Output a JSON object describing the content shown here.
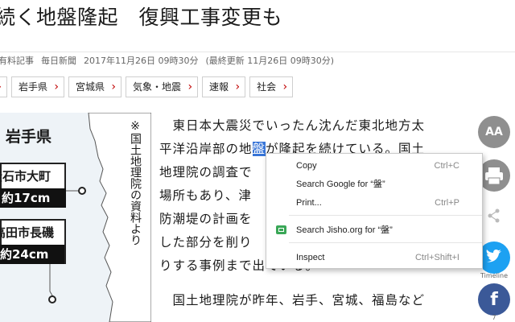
{
  "article": {
    "headline": "続く地盤隆起　復興工事変更も",
    "meta": {
      "category": "有料記事",
      "source": "毎日新聞",
      "published": "2017年11月26日 09時30分",
      "updated": "(最終更新 11月26日 09時30分)"
    },
    "tags": [
      "",
      "岩手県",
      "宮城県",
      "気象・地震",
      "速報",
      "社会"
    ],
    "body": {
      "line1": "東日本大震災でいったん沈んだ東北地方太",
      "line2_a": "平洋沿岸部の地",
      "line2_sel": "盤",
      "line2_b": "が隆起を続けている。国土",
      "line3": "地理院の調査で",
      "line4": "場所もあり、津",
      "line5": "防潮堤の計画を",
      "line6": "した部分を削り",
      "line7": "りする事例まで出ている。",
      "line8": "国土地理院が昨年、岩手、宮城、福島など"
    }
  },
  "figure": {
    "title": "岩手県",
    "note": "※国土地理院の資料より",
    "boxes": [
      {
        "place": "釜石市大町",
        "value": "約17cm"
      },
      {
        "place": "陸前高田市長磯",
        "value": "約24cm"
      }
    ]
  },
  "rail": {
    "font_size_label": "AA",
    "twitter_label": "Timeline",
    "facebook_count": "7"
  },
  "context_menu": {
    "items": [
      {
        "label": "Copy",
        "shortcut": "Ctrl+C"
      },
      {
        "label": "Search Google for “盤”",
        "shortcut": ""
      },
      {
        "label": "Print...",
        "shortcut": "Ctrl+P"
      },
      {
        "label": "Search Jisho.org for “盤”",
        "shortcut": ""
      },
      {
        "label": "Inspect",
        "shortcut": "Ctrl+Shift+I"
      }
    ]
  },
  "colors": {
    "selection": "#3875d7",
    "twitter": "#1da1f2",
    "facebook": "#3b5998",
    "tag_arrow": "#c00000"
  }
}
